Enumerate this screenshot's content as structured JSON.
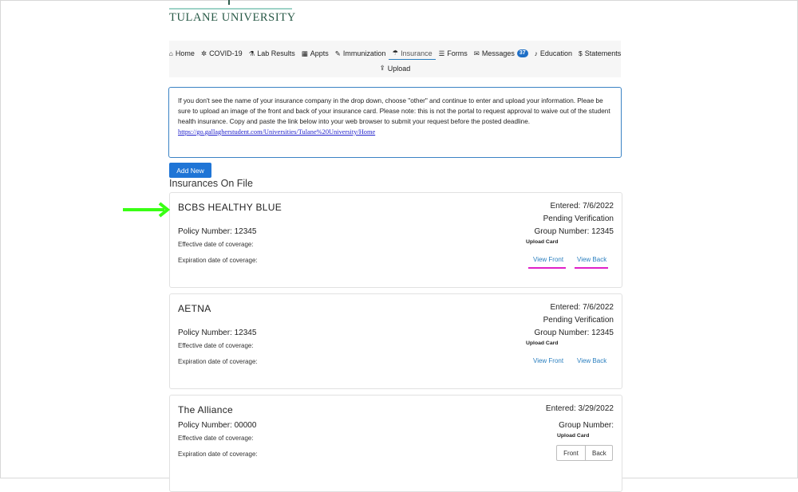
{
  "header": {
    "logo_text": "TULANE UNIVERSITY"
  },
  "nav": {
    "items": [
      {
        "icon": "home-icon",
        "glyph": "⌂",
        "label": "Home"
      },
      {
        "icon": "gear-icon",
        "glyph": "✲",
        "label": "COVID-19"
      },
      {
        "icon": "flask-icon",
        "glyph": "⚗",
        "label": "Lab Results"
      },
      {
        "icon": "calendar-icon",
        "glyph": "▦",
        "label": "Appts"
      },
      {
        "icon": "syringe-icon",
        "glyph": "✎",
        "label": "Immunization"
      },
      {
        "icon": "umbrella-icon",
        "glyph": "☂",
        "label": "Insurance"
      },
      {
        "icon": "list-icon",
        "glyph": "☰",
        "label": "Forms"
      },
      {
        "icon": "envelope-icon",
        "glyph": "✉",
        "label": "Messages",
        "badge": "37"
      },
      {
        "icon": "bell-icon",
        "glyph": "♪",
        "label": "Education"
      },
      {
        "icon": "dollar-icon",
        "glyph": "$",
        "label": "Statements"
      },
      {
        "icon": "upload-icon",
        "glyph": "⇪",
        "label": "Upload"
      }
    ],
    "active": "Insurance"
  },
  "notice": {
    "line1": "If you don't see the name of your insurance company in the drop down, choose \"other\" and continue to enter and upload your information. Pleae be sure to upload an image of the front and back of your insurance card. Please note: this is not the portal to request approval to waive out of the student health insurance. Copy and paste the link below into your web browser to submit your request before the posted deadline.",
    "link": "https://go.gallagherstudent.com/Universities/Tulane%20University/Home"
  },
  "add_new_label": "Add New",
  "section_title": "Insurances On File",
  "cards": [
    {
      "name": "BCBS HEALTHY BLUE",
      "entered": "Entered: 7/6/2022",
      "status": "Pending Verification",
      "policy": "Policy Number: 12345",
      "group": "Group Number: 12345",
      "effective": "Effective date of coverage:",
      "expiration": "Expiration date of coverage:",
      "upload_card": "Upload Card",
      "view_front": "View Front",
      "view_back": "View Back"
    },
    {
      "name": "AETNA",
      "entered": "Entered: 7/6/2022",
      "status": "Pending Verification",
      "policy": "Policy Number: 12345",
      "group": "Group Number: 12345",
      "effective": "Effective date of coverage:",
      "expiration": "Expiration date of coverage:",
      "upload_card": "Upload Card",
      "view_front": "View Front",
      "view_back": "View Back"
    },
    {
      "name": "The Alliance",
      "entered": "Entered: 3/29/2022",
      "policy": "Policy Number: 00000",
      "group": "Group Number:",
      "effective": "Effective date of coverage:",
      "expiration": "Expiration date of coverage:",
      "upload_card": "Upload Card",
      "front_btn": "Front",
      "back_btn": "Back"
    }
  ],
  "colors": {
    "accent_blue": "#1f75d6",
    "link_blue": "#2a7fbf",
    "annotation_arrow": "#39ff14",
    "annotation_underline": "#e021c8",
    "tulane_green": "#285946"
  }
}
